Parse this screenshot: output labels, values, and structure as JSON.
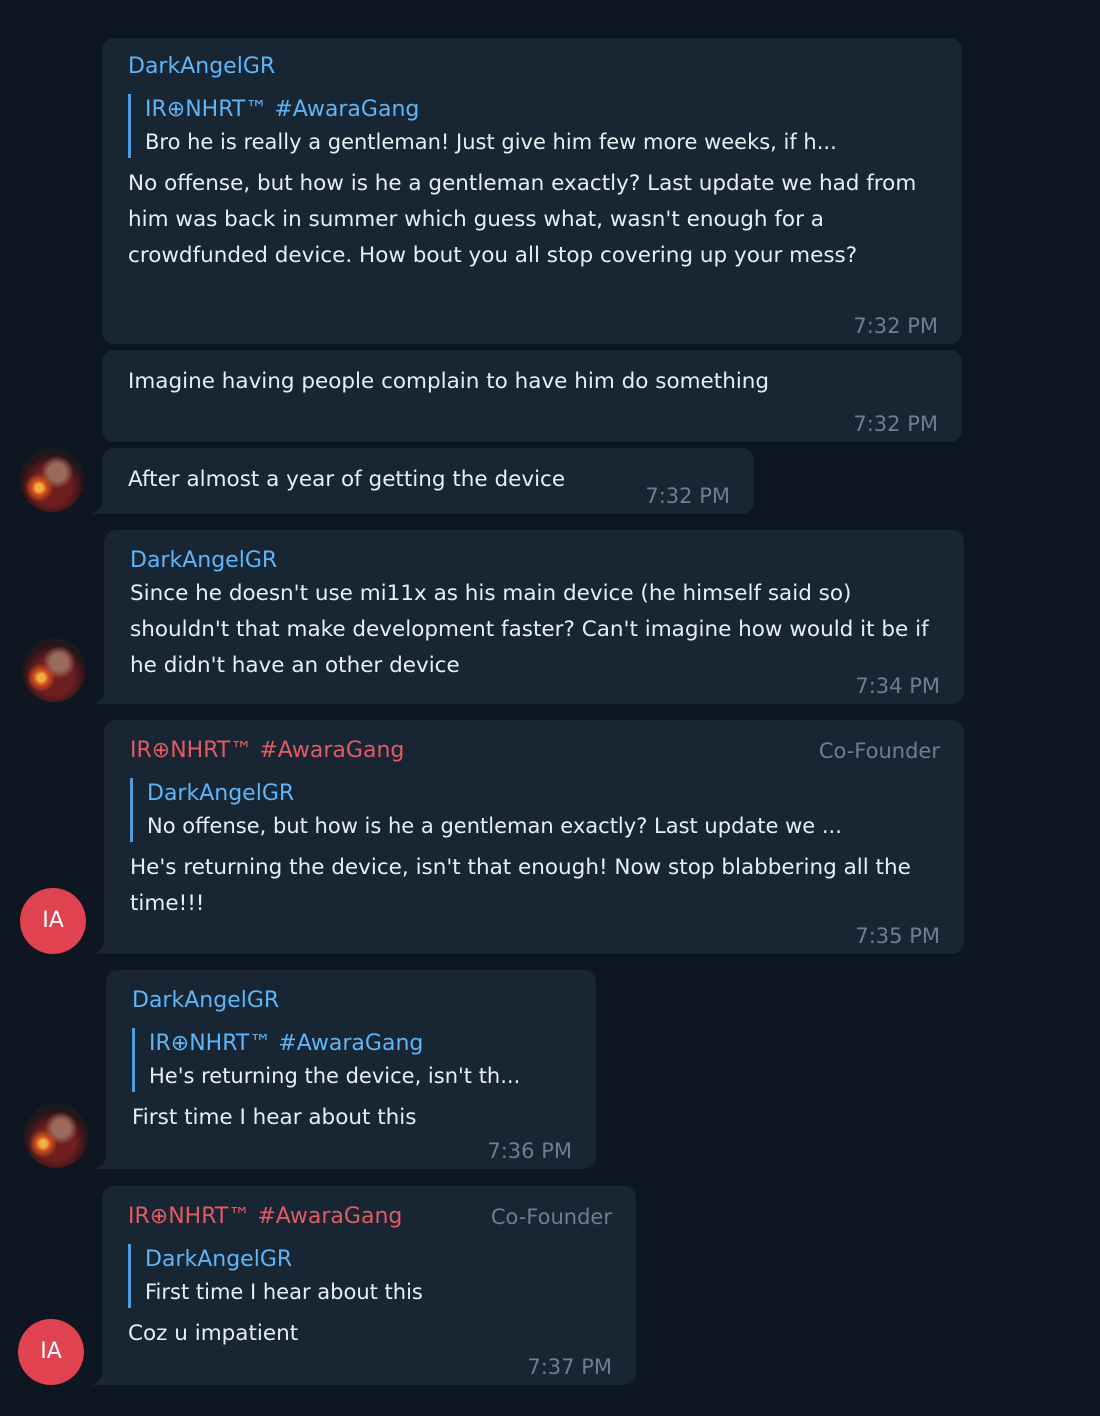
{
  "messages": [
    {
      "sender": "DarkAngelGR",
      "reply_name": "IR⊕NHRT™ #AwaraGang",
      "reply_text": "Bro he is really a gentleman! Just give him few more weeks, if h...",
      "text": "No offense, but how is he a gentleman exactly? Last update we had from him was back in summer which guess what, wasn't enough for a crowdfunded device. How bout you all stop covering up your mess?",
      "time": "7:32 PM"
    },
    {
      "text": "Imagine having people complain to have him do something",
      "time": "7:32 PM"
    },
    {
      "text": "After almost a year of getting the device",
      "time": "7:32 PM"
    },
    {
      "sender": "DarkAngelGR",
      "text": "Since he doesn't use mi11x as his main device (he himself said so) shouldn't that make development faster? Can't imagine how would it be if he didn't have an other device",
      "time": "7:34 PM"
    },
    {
      "sender": "IR⊕NHRT™ #AwaraGang",
      "role": "Co-Founder",
      "reply_name": "DarkAngelGR",
      "reply_text": "No offense, but how is he a gentleman exactly? Last update we ...",
      "text": "He's returning the device, isn't that enough! Now stop blabbering all the time!!!",
      "time": "7:35 PM",
      "avatar": "IA"
    },
    {
      "sender": "DarkAngelGR",
      "reply_name": "IR⊕NHRT™ #AwaraGang",
      "reply_text": "He's returning the device, isn't th...",
      "text": "First time I hear about this",
      "time": "7:36 PM"
    },
    {
      "sender": "IR⊕NHRT™ #AwaraGang",
      "role": "Co-Founder",
      "reply_name": "DarkAngelGR",
      "reply_text": "First time I hear about this",
      "text": "Coz u impatient",
      "time": "7:37 PM",
      "avatar": "IA"
    }
  ],
  "icons": {
    "user_avatar": "user-avatar-photo-icon"
  },
  "colors": {
    "background": "#0e1621",
    "bubble": "#182533",
    "name_blue": "#5eb5f7",
    "name_red": "#e15b64",
    "avatar_red": "#e0424f",
    "time_gray": "#6d7f8f"
  }
}
